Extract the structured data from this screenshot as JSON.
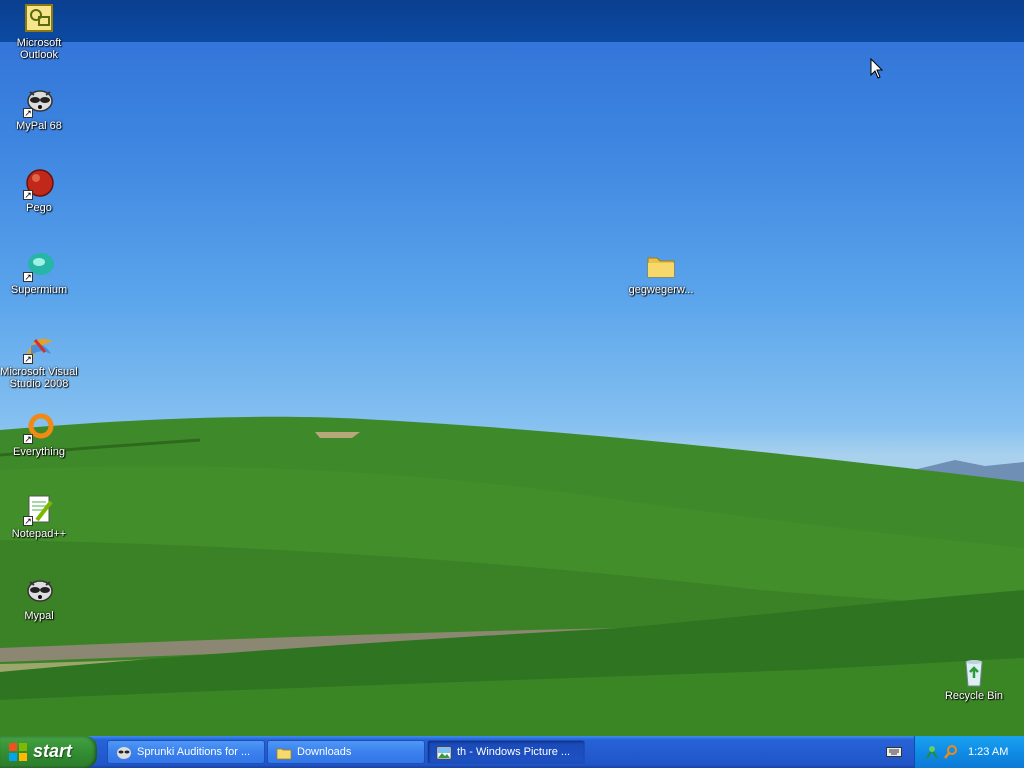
{
  "desktop": {
    "icons": [
      {
        "label": "Microsoft Outlook",
        "icon": "outlook-icon"
      },
      {
        "label": "MyPal 68",
        "icon": "raccoon-icon"
      },
      {
        "label": "Pego",
        "icon": "pego-icon"
      },
      {
        "label": "Supermium",
        "icon": "supermium-icon"
      },
      {
        "label": "Microsoft Visual Studio 2008",
        "icon": "visual-studio-icon"
      },
      {
        "label": "Everything",
        "icon": "everything-icon"
      },
      {
        "label": "Notepad++",
        "icon": "notepadpp-icon"
      },
      {
        "label": "Mypal",
        "icon": "raccoon-icon"
      },
      {
        "label": "gegwegerw...",
        "icon": "folder-icon"
      },
      {
        "label": "Recycle Bin",
        "icon": "recycle-bin-icon"
      }
    ]
  },
  "taskbar": {
    "start_label": "start",
    "tasks": [
      {
        "label": "Sprunki Auditions for ...",
        "icon": "raccoon-icon",
        "active": false
      },
      {
        "label": "Downloads",
        "icon": "folder-icon",
        "active": false
      },
      {
        "label": "th - Windows Picture ...",
        "icon": "picture-viewer-icon",
        "active": true
      }
    ],
    "clock": "1:23 AM"
  },
  "colors": {
    "taskbar_blue": "#245cd1",
    "start_green": "#3c9a3c",
    "tray_blue": "#0f8ce6"
  }
}
